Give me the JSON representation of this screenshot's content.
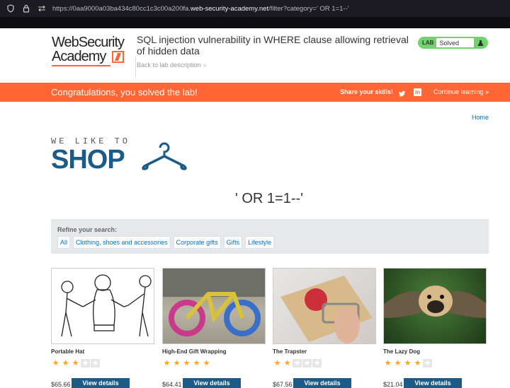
{
  "browser": {
    "url_prefix": "https://0aa9000a03ba434c80cc1c3c00a200fa.",
    "url_domain": "web-security-academy.net",
    "url_rest": "/filter?category=' OR 1=1--'"
  },
  "academy": {
    "logo_line1": "WebSecurity",
    "logo_line2": "Academy",
    "lab_title": "SQL injection vulnerability in WHERE clause allowing retrieval of hidden data",
    "back_link": "Back to lab description",
    "badge_label": "LAB",
    "badge_status": "Solved"
  },
  "banner": {
    "congrats": "Congratulations, you solved the lab!",
    "share": "Share your skills!",
    "continue": "Continue learning"
  },
  "nav": {
    "home": "Home"
  },
  "shop_logo": {
    "tagline": "WE LIKE TO",
    "word": "SHOP"
  },
  "filter": {
    "heading": "' OR 1=1--'",
    "refine_label": "Refine your search:",
    "categories": [
      "All",
      "Clothing, shoes and accessories",
      "Corporate gifts",
      "Gifts",
      "Lifestyle"
    ]
  },
  "colors": {
    "accent_orange": "#ff6633",
    "brand_blue": "#1a5c87",
    "solved_green": "#70d16d"
  },
  "products": [
    {
      "name": "Portable Hat",
      "rating": 3,
      "price": "$65.66",
      "button": "View details"
    },
    {
      "name": "High-End Gift Wrapping",
      "rating": 5,
      "price": "$64.41",
      "button": "View details"
    },
    {
      "name": "The Trapster",
      "rating": 2,
      "price": "$67.56",
      "button": "View details"
    },
    {
      "name": "The Lazy Dog",
      "rating": 4,
      "price": "$21.04",
      "button": "View details"
    }
  ]
}
